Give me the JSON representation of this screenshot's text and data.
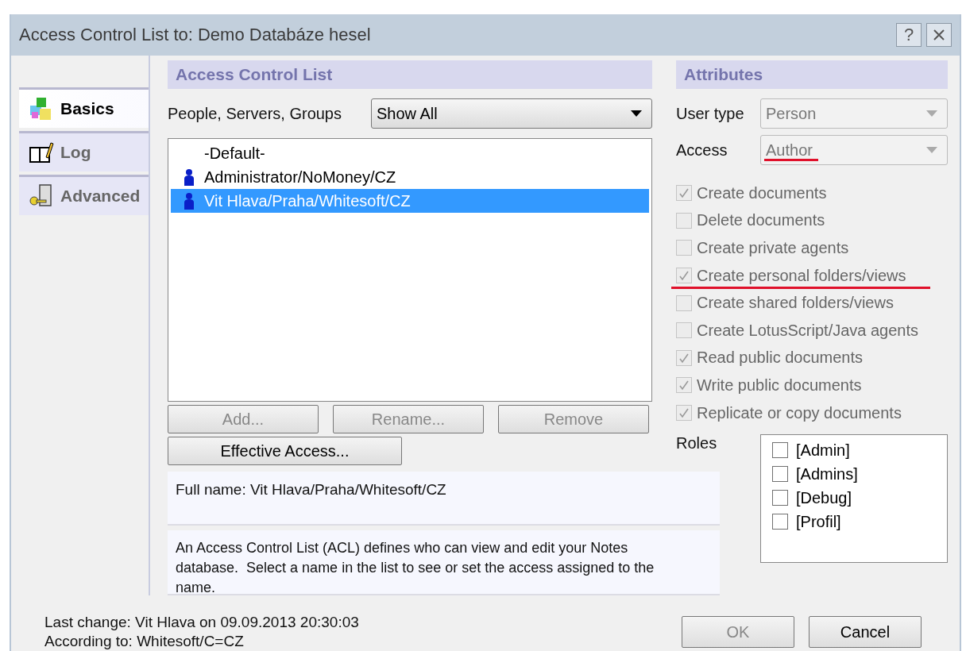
{
  "window": {
    "title": "Access Control List to: Demo Databáze hesel",
    "buttons": [
      {
        "kind": "help",
        "label": "?"
      },
      {
        "kind": "close"
      }
    ]
  },
  "tabs": [
    {
      "label": "Basics",
      "kind": "basics",
      "selected": true
    },
    {
      "label": "Log",
      "kind": "log",
      "selected": false
    },
    {
      "label": "Advanced",
      "kind": "advanced",
      "selected": false
    }
  ],
  "acl": {
    "title": "Access Control List",
    "filter_label": "People, Servers, Groups",
    "filter": {
      "value": "Show All"
    },
    "entries": [
      {
        "name": "-Default-",
        "kind": "default",
        "selected": false
      },
      {
        "name": "Administrator/NoMoney/CZ",
        "kind": "person",
        "selected": false
      },
      {
        "name": "Vit Hlava/Praha/Whitesoft/CZ",
        "kind": "person",
        "selected": true
      }
    ],
    "buttons": [
      {
        "label": "Add...",
        "disabled": true
      },
      {
        "label": "Rename...",
        "disabled": true
      },
      {
        "label": "Remove",
        "disabled": true
      }
    ],
    "effective_access": {
      "label": "Effective Access...",
      "disabled": false
    },
    "full_name": "Full name: Vit Hlava/Praha/Whitesoft/CZ",
    "description": "An Access Control List (ACL) defines who can view and edit your Notes\ndatabase.  Select a name in the list to see or set the access assigned to the\nname."
  },
  "attributes": {
    "title": "Attributes",
    "fields": [
      {
        "label": "User type",
        "value": "Person",
        "disabled": true,
        "highlighted": false
      },
      {
        "label": "Access",
        "value": "Author",
        "disabled": true,
        "highlighted": true
      }
    ],
    "options": [
      {
        "label": "Create documents",
        "checked": true,
        "disabled": true,
        "highlighted": false
      },
      {
        "label": "Delete documents",
        "checked": false,
        "disabled": true,
        "highlighted": false
      },
      {
        "label": "Create private agents",
        "checked": false,
        "disabled": true,
        "highlighted": false
      },
      {
        "label": "Create personal folders/views",
        "checked": true,
        "disabled": true,
        "highlighted": true
      },
      {
        "label": "Create shared folders/views",
        "checked": false,
        "disabled": true,
        "highlighted": false
      },
      {
        "label": "Create LotusScript/Java agents",
        "checked": false,
        "disabled": true,
        "highlighted": false
      },
      {
        "label": "Read public documents",
        "checked": true,
        "disabled": true,
        "highlighted": false
      },
      {
        "label": "Write public documents",
        "checked": true,
        "disabled": true,
        "highlighted": false
      },
      {
        "label": "Replicate or copy documents",
        "checked": true,
        "disabled": true,
        "highlighted": false
      }
    ],
    "roles_label": "Roles",
    "roles": [
      {
        "label": "[Admin]",
        "checked": false
      },
      {
        "label": "[Admins]",
        "checked": false
      },
      {
        "label": "[Debug]",
        "checked": false
      },
      {
        "label": "[Profil]",
        "checked": false
      }
    ]
  },
  "footer": {
    "lines": [
      "Last change: Vit Hlava on 09.09.2013 20:30:03",
      "According to: Whitesoft/C=CZ"
    ],
    "buttons": [
      {
        "label": "OK",
        "disabled": true
      },
      {
        "label": "Cancel",
        "disabled": false
      }
    ]
  }
}
